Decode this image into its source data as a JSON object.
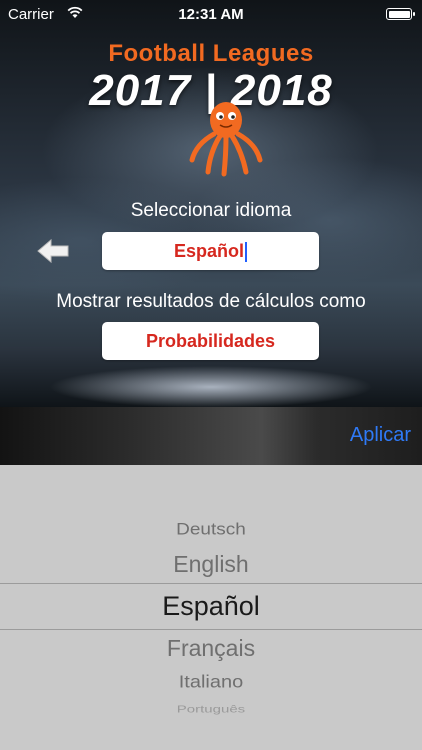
{
  "status_bar": {
    "carrier": "Carrier",
    "time": "12:31 AM"
  },
  "header": {
    "title": "Football Leagues",
    "season": "2017 | 2018"
  },
  "language_section": {
    "label": "Seleccionar idioma",
    "value": "Español"
  },
  "results_section": {
    "label": "Mostrar resultados de cálculos como",
    "value": "Probabilidades"
  },
  "toolbar": {
    "apply_label": "Aplicar"
  },
  "picker": {
    "options": [
      "Deutsch",
      "English",
      "Español",
      "Français",
      "Italiano",
      "Português"
    ],
    "selected": "Español"
  },
  "colors": {
    "accent_blue": "#2f7af7",
    "value_red": "#d6281f",
    "brand_orange": "#f26a21"
  }
}
